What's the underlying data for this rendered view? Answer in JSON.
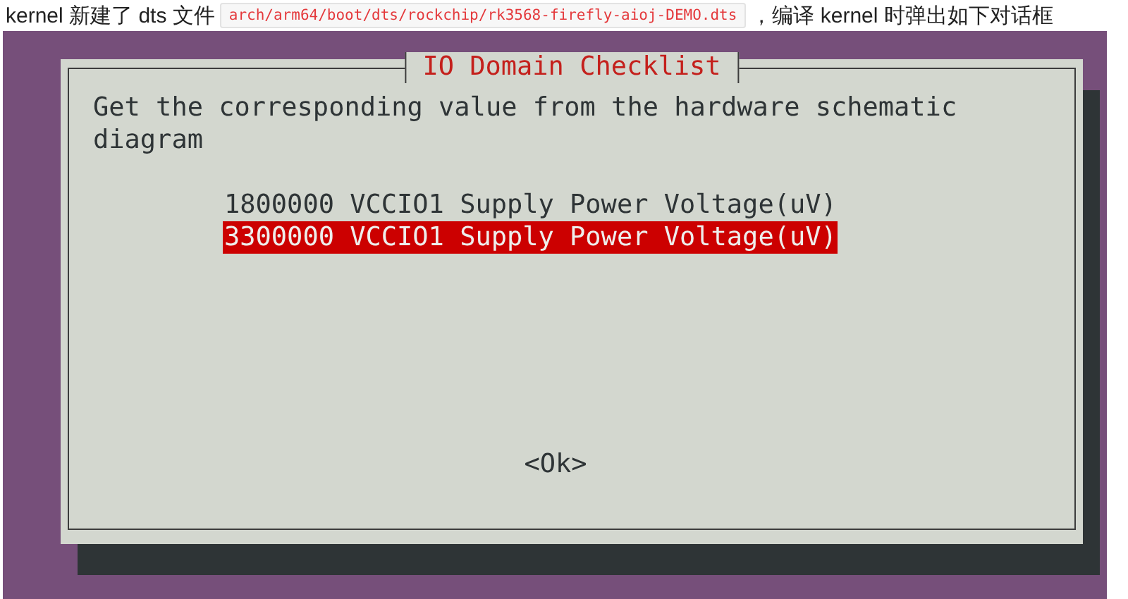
{
  "caption": {
    "text_before": "kernel 新建了 dts 文件",
    "code": "arch/arm64/boot/dts/rockchip/rk3568-firefly-aioj-DEMO.dts",
    "text_after": "，编译 kernel 时弹出如下对话框"
  },
  "dialog": {
    "title": "IO Domain Checklist",
    "prompt": "Get the corresponding value from the hardware schematic diagram",
    "options": [
      {
        "label": "1800000 VCCIO1 Supply Power Voltage(uV)",
        "selected": false
      },
      {
        "label": "3300000 VCCIO1 Supply Power Voltage(uV)",
        "selected": true
      }
    ],
    "button": "<Ok>"
  }
}
